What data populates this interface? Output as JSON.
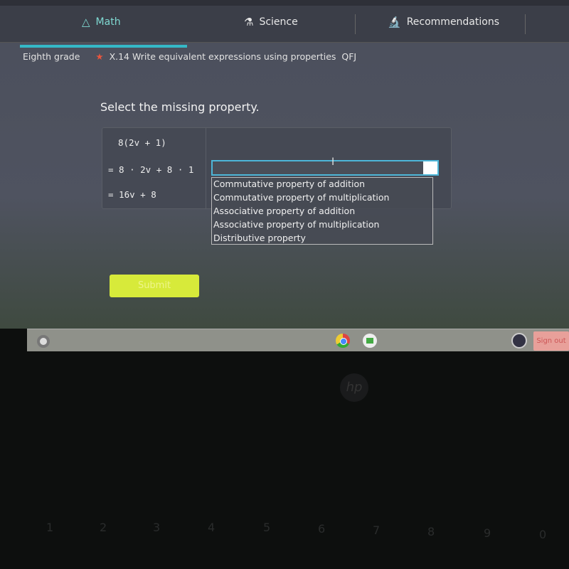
{
  "nav": {
    "tabs": [
      {
        "label": "Math",
        "icon": "triangle-ruler-icon"
      },
      {
        "label": "Science",
        "icon": "flask-icon"
      },
      {
        "label": "Recommendations",
        "icon": "microscope-icon"
      }
    ],
    "active": "Math"
  },
  "breadcrumb": {
    "grade": "Eighth grade",
    "skill": "X.14 Write equivalent expressions using properties",
    "code": "QFJ"
  },
  "question": "Select the missing property.",
  "steps": [
    "8(2v + 1)",
    "= 8 · 2v + 8 · 1",
    "= 16v + 8"
  ],
  "dropdown": {
    "value": "",
    "options": [
      "Commutative property of addition",
      "Commutative property of multiplication",
      "Associative property of addition",
      "Associative property of multiplication",
      "Distributive property"
    ]
  },
  "submit": "Submit",
  "shelf": {
    "sign_out": "Sign out"
  },
  "colors": {
    "accent": "#35b8c6",
    "submit": "#d7ea3a",
    "star": "#e8553d"
  },
  "keyboard": {
    "numbers": [
      "1",
      "2",
      "3",
      "4",
      "5",
      "6",
      "7",
      "8",
      "9",
      "0"
    ]
  }
}
